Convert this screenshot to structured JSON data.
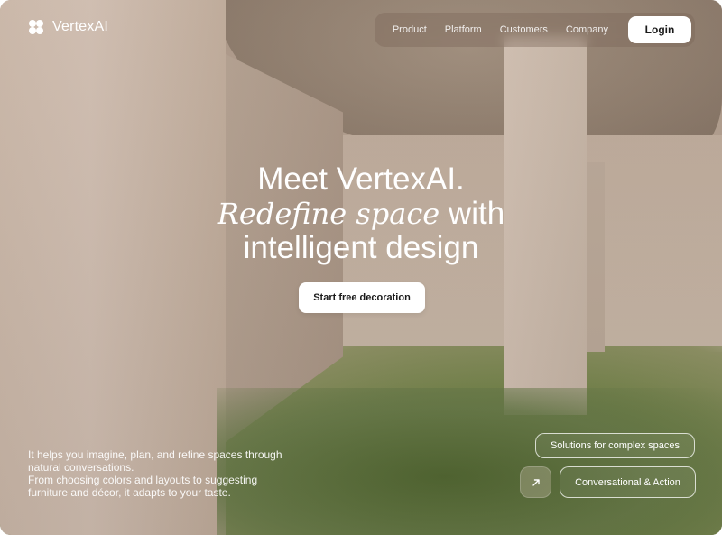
{
  "brand": {
    "name": "VertexAI",
    "icon": "four-petal-logo-icon"
  },
  "nav": {
    "links": [
      "Product",
      "Platform",
      "Customers",
      "Company"
    ],
    "login_label": "Login"
  },
  "hero": {
    "line1": "Meet VertexAI.",
    "line2_italic": "Redefine space",
    "line2_rest": "with",
    "line3": "intelligent design",
    "cta_label": "Start free decoration"
  },
  "description": {
    "paragraph1": "It helps you imagine, plan, and refine spaces through natural conversations.",
    "paragraph2": "From choosing colors and layouts to suggesting furniture and décor, it adapts to your taste."
  },
  "features": {
    "solutions_label": "Solutions for complex spaces",
    "conversational_label": "Conversational & Action",
    "arrow_icon": "arrow-up-right-icon"
  },
  "colors": {
    "text": "#ffffff",
    "button_bg": "#ffffff",
    "button_text": "#1b1b1b"
  }
}
